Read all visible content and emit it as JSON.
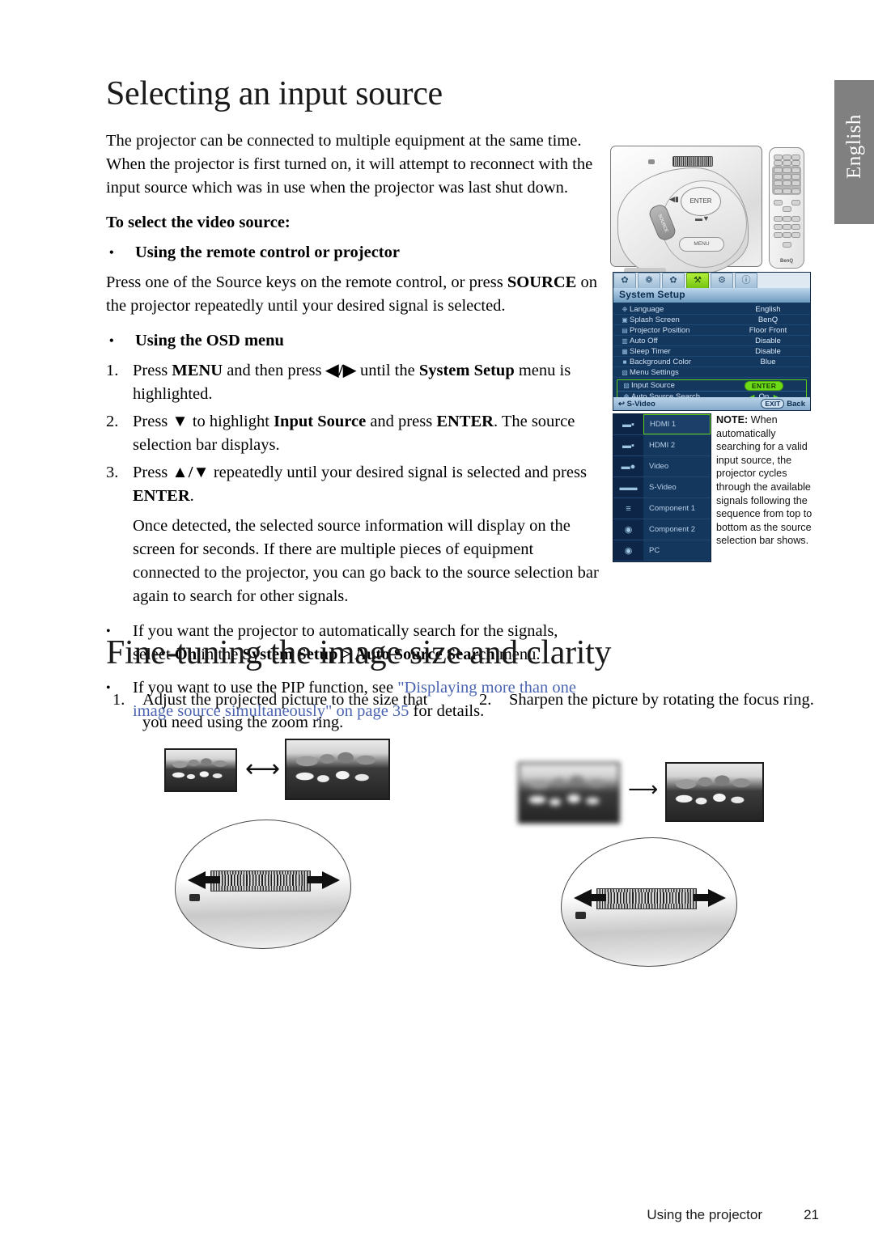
{
  "side_tab": {
    "label": "English"
  },
  "headings": {
    "input_source": "Selecting an input source",
    "fine_tuning": "Fine-tuning the image size and clarity"
  },
  "intro": {
    "paragraph": "The projector can be connected to multiple equipment at the same time. When the projector is first turned on, it will attempt to reconnect with the input source which was in use when the projector was last shut down."
  },
  "section": {
    "sub_head": "To select the video source:",
    "bullet_remote": {
      "dot": "•",
      "label": "Using the remote control or projector"
    },
    "remote_para_1": "Press one of the Source keys on the remote control, or press ",
    "remote_para_bold": "SOURCE",
    "remote_para_2": " on the projector repeatedly until your desired signal is selected.",
    "bullet_osd": {
      "dot": "•",
      "label": "Using the OSD menu"
    }
  },
  "steps": [
    {
      "num": "1.",
      "part1": "Press ",
      "bold1": "MENU",
      "part2": " and then press ",
      "keys": "◀/▶",
      "part3": " until the ",
      "bold2": "System Setup",
      "part4": " menu is highlighted."
    },
    {
      "num": "2.",
      "part1": "Press ",
      "keys": "▼",
      "part2": " to highlight ",
      "bold1": "Input Source",
      "part3": " and press ",
      "bold2": "ENTER",
      "part4": ". The source selection bar displays."
    },
    {
      "num": "3.",
      "part1": "Press ",
      "keys": "▲/▼",
      "part2": " repeatedly until your desired signal is selected and press ",
      "bold1": "ENTER",
      "part3": "."
    }
  ],
  "detected_para": "Once detected, the selected source information will display on the screen for seconds. If there are multiple pieces of equipment connected to the projector, you can go back to the source selection bar again to search for other signals.",
  "tail_bullets": [
    {
      "dot": "•",
      "part1": "If you want the projector to automatically search for the signals, select ",
      "bold1": "On",
      "part2": " in the ",
      "bold2": "System Setup > Auto Source Search",
      "part3": " menu."
    },
    {
      "dot": "•",
      "part1": "If you want to use the PIP function, see ",
      "link": "\"Displaying more than one image source simultaneously\" on page 35",
      "part2": " for details."
    }
  ],
  "illustration": {
    "projector": {
      "enter_label": "ENTER",
      "source_label": "SOURCE",
      "menu_label": "MENU",
      "left_arrow": "◀▮",
      "down_arrow": "▬▼"
    },
    "remote": {
      "brand": "BenQ"
    }
  },
  "osd": {
    "tabs": [
      {
        "name": "picture-basic-tab",
        "glyph": "✿",
        "active": false
      },
      {
        "name": "picture-advanced-tab",
        "glyph": "❁",
        "active": false
      },
      {
        "name": "display-tab",
        "glyph": "✿",
        "active": false
      },
      {
        "name": "system-setup-basic-tab",
        "glyph": "⚒",
        "active": true
      },
      {
        "name": "system-setup-advanced-tab",
        "glyph": "⚙",
        "active": false
      },
      {
        "name": "information-tab",
        "glyph": "ⓘ",
        "active": false
      }
    ],
    "title": "System Setup",
    "rows": [
      {
        "icon": "❉",
        "label": "Language",
        "value": "English"
      },
      {
        "icon": "▣",
        "label": "Splash Screen",
        "value": "BenQ"
      },
      {
        "icon": "▤",
        "label": "Projector Position",
        "value": "Floor Front"
      },
      {
        "icon": "▥",
        "label": "Auto Off",
        "value": "Disable"
      },
      {
        "icon": "▦",
        "label": "Sleep Timer",
        "value": "Disable"
      },
      {
        "icon": "■",
        "label": "Background Color",
        "value": "Blue"
      },
      {
        "icon": "▧",
        "label": "Menu Settings",
        "value": ""
      }
    ],
    "highlighted": [
      {
        "icon": "▨",
        "label": "Input Source",
        "value": "ENTER",
        "is_badge": true
      },
      {
        "icon": "❆",
        "label": "Auto Source Search",
        "value": "On",
        "left_arrow": "◀",
        "right_arrow": "▶"
      }
    ],
    "footer": {
      "icon": "↩",
      "source": "S-Video",
      "exit_key": "EXIT",
      "exit_label": "Back"
    }
  },
  "source_bar": {
    "items": [
      {
        "label": "HDMI 1",
        "icon": "▬▪",
        "selected": true
      },
      {
        "label": "HDMI 2",
        "icon": "▬▪",
        "selected": false
      },
      {
        "label": "Video",
        "icon": "▬●",
        "selected": false
      },
      {
        "label": "S-Video",
        "icon": "▬▬",
        "selected": false
      },
      {
        "label": "Component 1",
        "icon": "≡",
        "selected": false
      },
      {
        "label": "Component 2",
        "icon": "◉",
        "selected": false
      },
      {
        "label": "PC",
        "icon": "◉",
        "selected": false
      }
    ]
  },
  "note": {
    "bold": "NOTE:",
    "text": " When automatically searching for a valid input source, the projector cycles through the available signals following the sequence from top to bottom as the source selection bar shows."
  },
  "fine_tuning_steps": [
    {
      "num": "1.",
      "text": "Adjust the projected picture to the size that you need using the zoom ring."
    },
    {
      "num": "2.",
      "text": "Sharpen the picture by rotating the focus ring."
    }
  ],
  "diagram_arrows": {
    "zoom": "⟷",
    "focus": "⟶"
  },
  "footer": {
    "label": "Using the projector",
    "page": "21"
  },
  "colors": {
    "link": "#4a64b0",
    "osd_background": "#14375e",
    "osd_highlight": "#5fd018",
    "osd_title_text": "#0d2d50",
    "side_tab": "#808080"
  }
}
